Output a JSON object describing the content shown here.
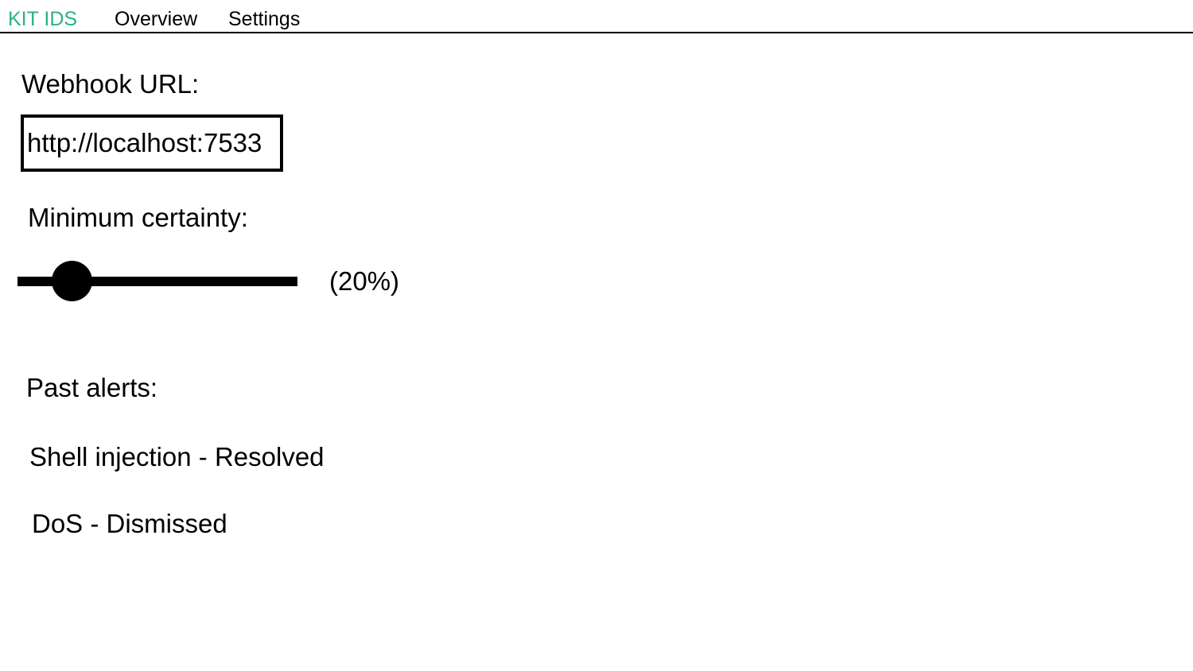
{
  "nav": {
    "brand": "KIT IDS",
    "brand_color": "#2bb08a",
    "links": [
      "Overview",
      "Settings"
    ]
  },
  "settings": {
    "webhook_label": "Webhook URL:",
    "webhook_value": "http://localhost:7533",
    "certainty_label": "Minimum certainty:",
    "certainty_fraction": 0.2,
    "certainty_text": "(20%)",
    "alerts_label": "Past alerts:",
    "alerts": [
      "Shell injection - Resolved",
      "DoS - Dismissed"
    ]
  }
}
